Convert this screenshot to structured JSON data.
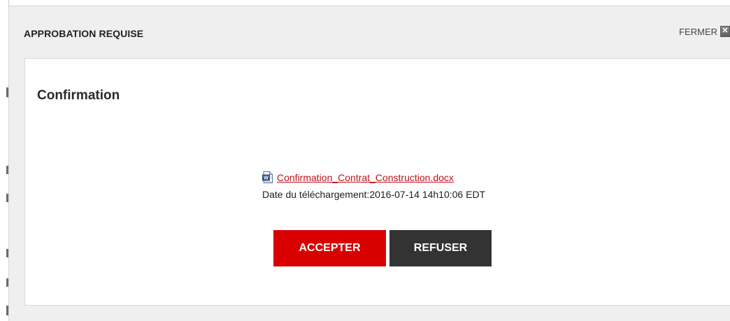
{
  "dialog": {
    "title": "APPROBATION REQUISE",
    "close_label": "FERMER",
    "close_icon": "close-icon"
  },
  "body": {
    "heading": "Confirmation",
    "file": {
      "icon": "word-document-icon",
      "name": "Confirmation_Contrat_Construction.docx"
    },
    "upload_date": "Date du téléchargement:2016-07-14 14h10:06 EDT"
  },
  "actions": {
    "accept_label": "ACCEPTER",
    "refuse_label": "REFUSER"
  },
  "colors": {
    "accent": "#d90000",
    "secondary_button": "#333333",
    "link": "#c0101a",
    "header_bg": "#efefef"
  }
}
